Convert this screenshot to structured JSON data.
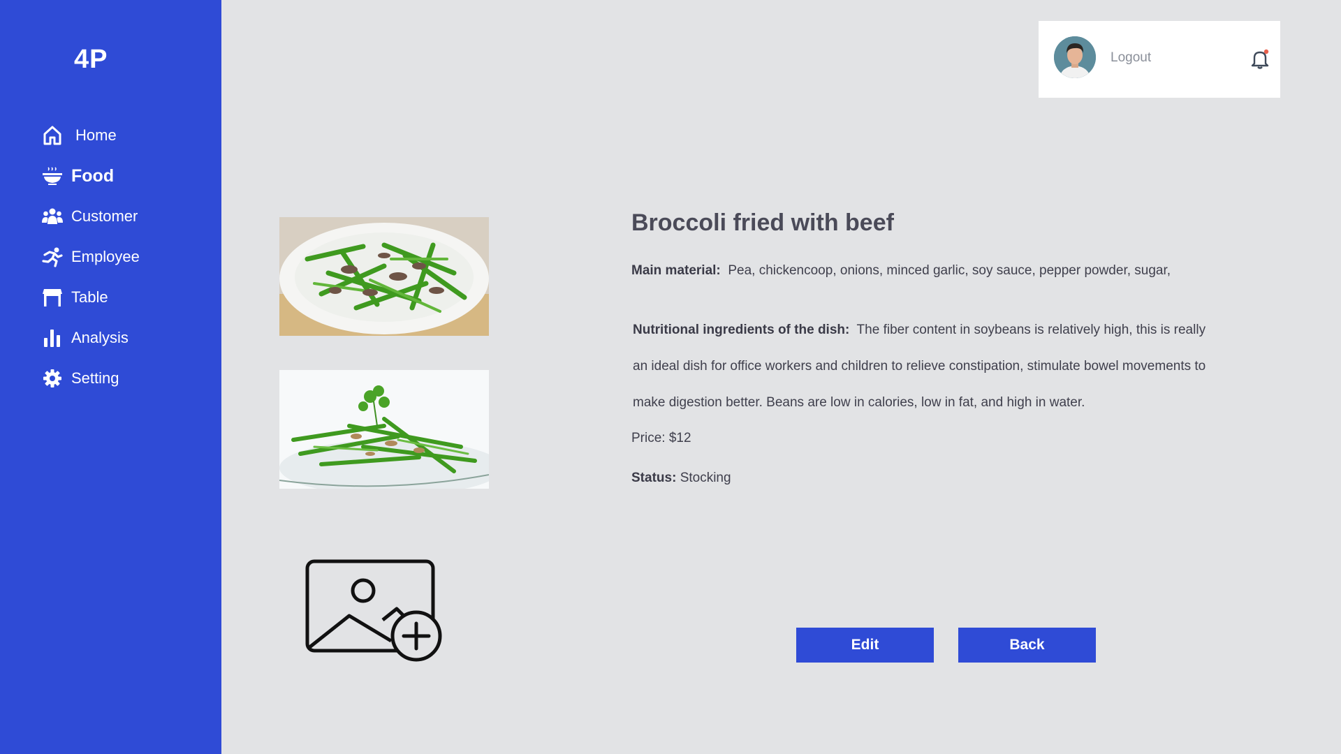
{
  "app": {
    "logo": "4P"
  },
  "sidebar": {
    "items": [
      {
        "label": "Home",
        "icon": "home-icon"
      },
      {
        "label": "Food",
        "icon": "bowl-icon",
        "active": true
      },
      {
        "label": "Customer",
        "icon": "users-icon"
      },
      {
        "label": "Employee",
        "icon": "running-person-icon"
      },
      {
        "label": "Table",
        "icon": "table-icon"
      },
      {
        "label": "Analysis",
        "icon": "bar-chart-icon"
      },
      {
        "label": "Setting",
        "icon": "gear-icon"
      }
    ]
  },
  "header": {
    "logout_label": "Logout",
    "notification_icon": "bell-icon",
    "notification_dot_color": "#e8604c"
  },
  "dish": {
    "title": "Broccoli fried with beef",
    "material_label": "Main material:",
    "material_value": "Pea, chickencoop, onions, minced garlic, soy sauce, pepper powder, sugar,",
    "nutrition_label": "Nutritional ingredients of the dish:",
    "nutrition_value": "The fiber  content in  soybeans is  relatively high,  this is really an ideal dish for office  workers and  children to relieve  constipation, stimulate bowel movements to make digestion better. Beans are low in calories, low in fat, and high in water.",
    "price_text": "Price: $12",
    "status_label": "Status:",
    "status_value": "Stocking"
  },
  "actions": {
    "edit_label": "Edit",
    "back_label": "Back"
  },
  "colors": {
    "accent": "#2f4bd6",
    "background": "#e2e3e5"
  }
}
